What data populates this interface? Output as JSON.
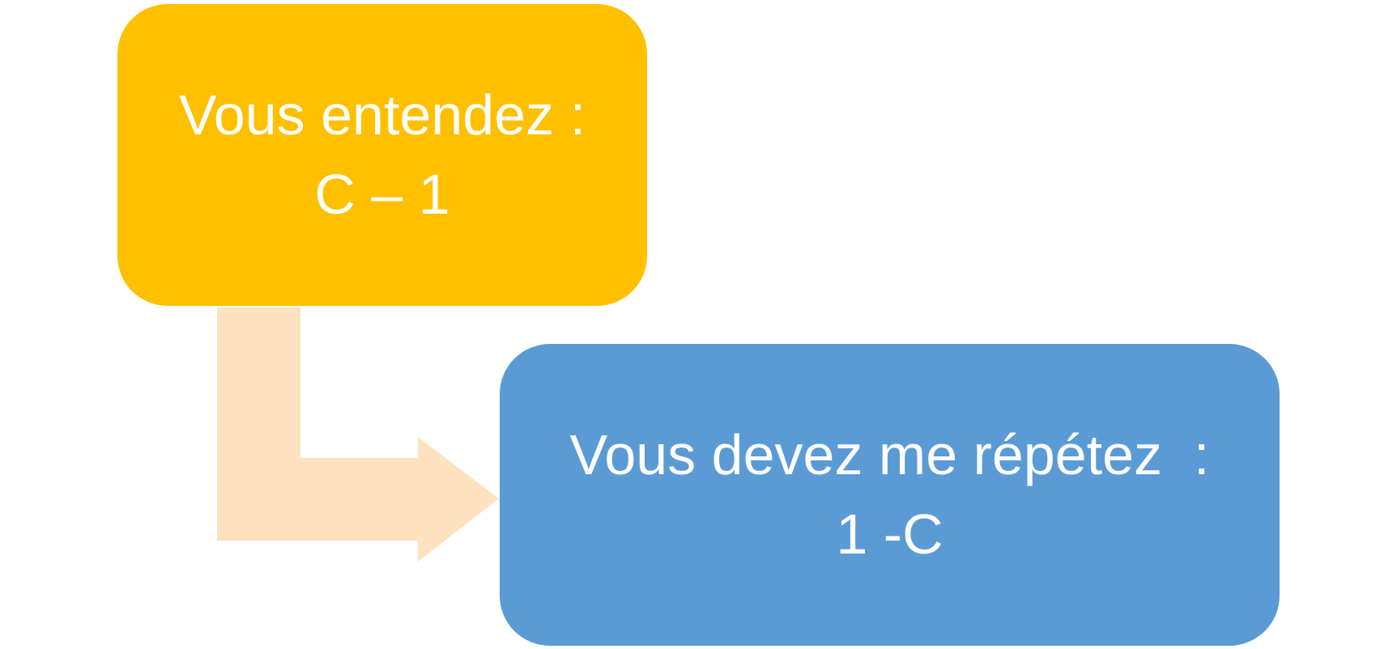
{
  "colors": {
    "heard_box": "#FFC000",
    "repeat_box": "#5B9BD5",
    "arrow": "#FEE1BE",
    "text": "#FFFFFF"
  },
  "heard_box": {
    "label": "Vous entendez :",
    "value": "C – 1"
  },
  "repeat_box": {
    "label": "Vous devez me répétez  :",
    "value": "1 -C"
  }
}
